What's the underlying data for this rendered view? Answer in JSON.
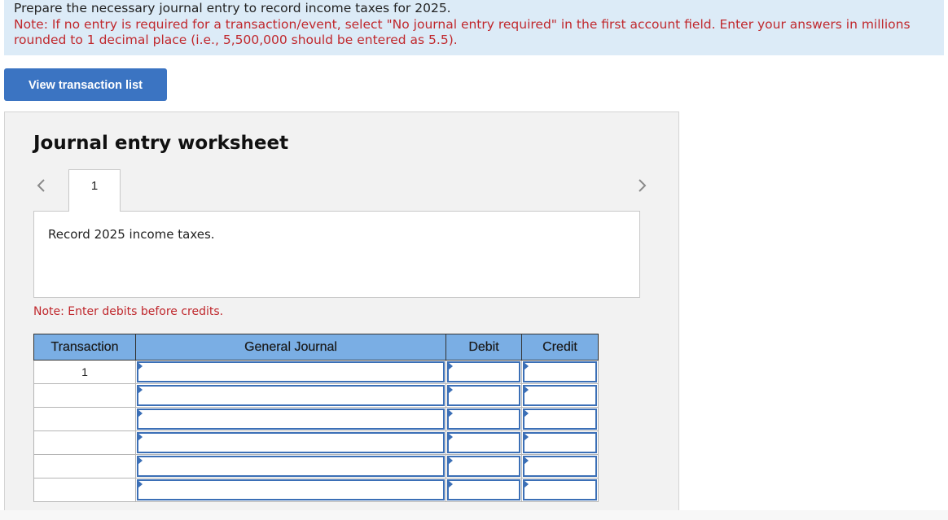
{
  "instructions": {
    "main": "Prepare the necessary journal entry to record income taxes for 2025.",
    "note": "Note: If no entry is required for a transaction/event, select \"No journal entry required\" in the first account field. Enter your answers in millions rounded to 1 decimal place (i.e., 5,500,000 should be entered as 5.5)."
  },
  "buttons": {
    "view_transaction_list": "View transaction list"
  },
  "worksheet": {
    "title": "Journal entry worksheet",
    "tab_label": "1",
    "description": "Record 2025 income taxes.",
    "debit_note": "Note: Enter debits before credits."
  },
  "table": {
    "headers": [
      "Transaction",
      "General Journal",
      "Debit",
      "Credit"
    ],
    "rows": [
      {
        "transaction": "1",
        "account": "",
        "debit": "",
        "credit": ""
      },
      {
        "transaction": "",
        "account": "",
        "debit": "",
        "credit": ""
      },
      {
        "transaction": "",
        "account": "",
        "debit": "",
        "credit": ""
      },
      {
        "transaction": "",
        "account": "",
        "debit": "",
        "credit": ""
      },
      {
        "transaction": "",
        "account": "",
        "debit": "",
        "credit": ""
      },
      {
        "transaction": "",
        "account": "",
        "debit": "",
        "credit": ""
      }
    ]
  },
  "icons": {
    "prev": "chevron-left-icon",
    "next": "chevron-right-icon"
  },
  "colors": {
    "instruction_bg": "#dcebf7",
    "note_red": "#c0282d",
    "button_blue": "#3b74c2",
    "header_blue": "#7aaee4"
  }
}
